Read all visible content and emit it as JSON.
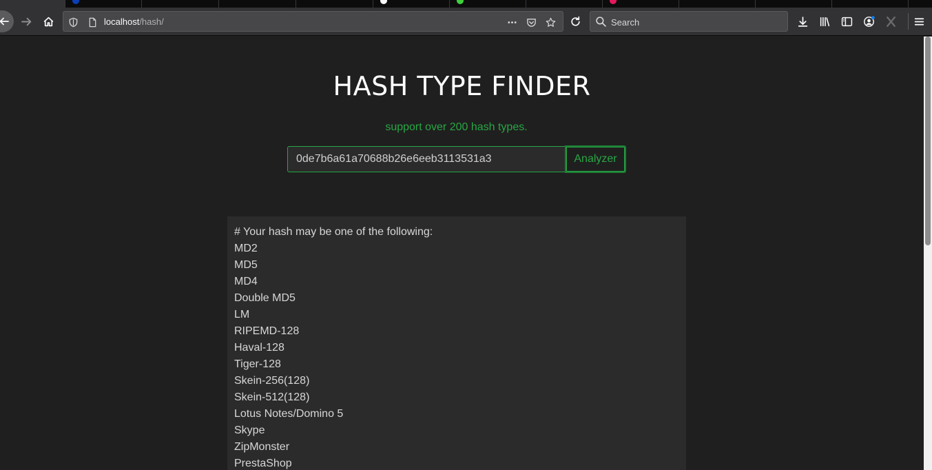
{
  "browser": {
    "url_host": "localhost",
    "url_path": "/hash/",
    "search_placeholder": "Search"
  },
  "page": {
    "title": "HASH TYPE FINDER",
    "subtitle": "support over 200 hash types.",
    "hash_value": "0de7b6a61a70688b26e6eeb3113531a3",
    "analyze_label": "Analyzer",
    "results_header": "# Your hash may be one of the following:",
    "results": [
      "MD2",
      "MD5",
      "MD4",
      "Double MD5",
      "LM",
      "RIPEMD-128",
      "Haval-128",
      "Tiger-128",
      "Skein-256(128)",
      "Skein-512(128)",
      "Lotus Notes/Domino 5",
      "Skype",
      "ZipMonster",
      "PrestaShop"
    ]
  },
  "colors": {
    "accent": "#28a745",
    "background": "#1f1f1f",
    "panel": "#2b2b2b"
  }
}
